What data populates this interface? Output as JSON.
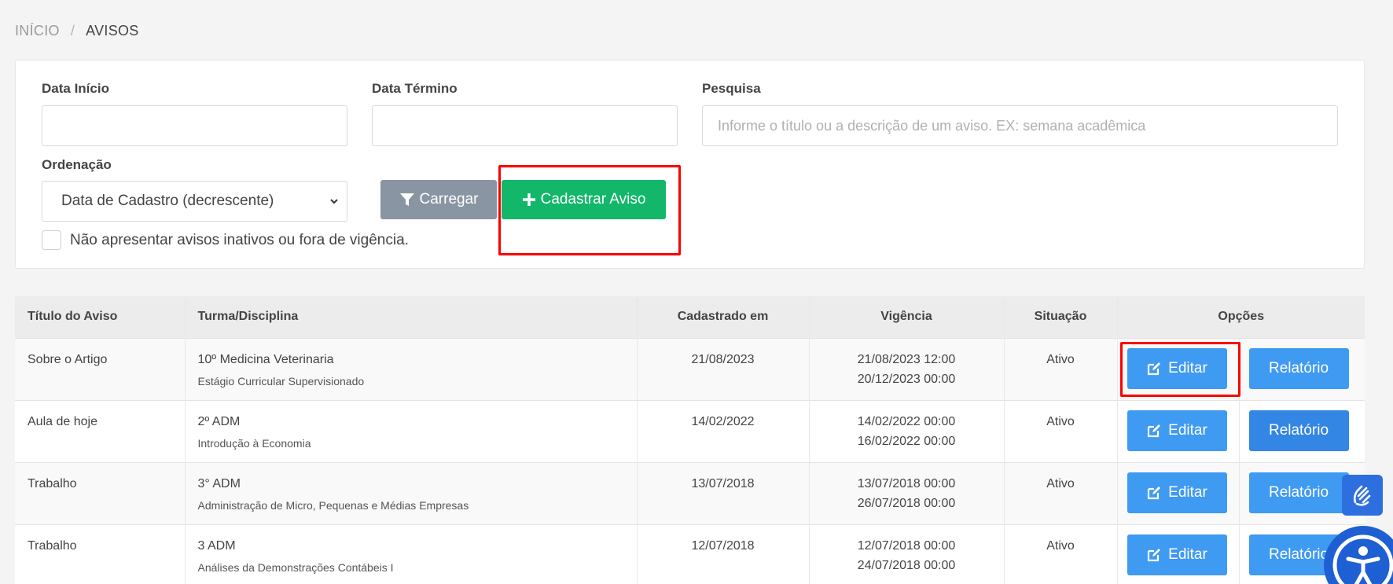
{
  "breadcrumb": {
    "home": "INÍCIO",
    "separator": "/",
    "current": "AVISOS"
  },
  "filters": {
    "start_label": "Data Início",
    "start_value": "",
    "end_label": "Data Término",
    "end_value": "",
    "search_label": "Pesquisa",
    "search_placeholder": "Informe o título ou a descrição de um aviso. EX: semana acadêmica",
    "search_value": "",
    "order_label": "Ordenação",
    "order_selected": "Data de Cadastro (decrescente)",
    "load_button": "Carregar",
    "new_button": "Cadastrar Aviso",
    "inactive_checkbox_label": "Não apresentar avisos inativos ou fora de vigência.",
    "inactive_checked": false
  },
  "table": {
    "headers": [
      "Título do Aviso",
      "Turma/Disciplina",
      "Cadastrado em",
      "Vigência",
      "Situação",
      "Opções"
    ],
    "rows": [
      {
        "title": "Sobre o Artigo",
        "class": "10º Medicina Veterinaria",
        "subject": "Estágio Curricular Supervisionado",
        "created": "21/08/2023",
        "start": "21/08/2023 12:00",
        "end": "20/12/2023 00:00",
        "status": "Ativo",
        "edit": "Editar",
        "report": "Relatório"
      },
      {
        "title": "Aula de hoje",
        "class": "2º ADM",
        "subject": "Introdução à Economia",
        "created": "14/02/2022",
        "start": "14/02/2022 00:00",
        "end": "16/02/2022 00:00",
        "status": "Ativo",
        "edit": "Editar",
        "report": "Relatório"
      },
      {
        "title": "Trabalho",
        "class": "3° ADM",
        "subject": "Administração de Micro, Pequenas e Médias Empresas",
        "created": "13/07/2018",
        "start": "13/07/2018 00:00",
        "end": "26/07/2018 00:00",
        "status": "Ativo",
        "edit": "Editar",
        "report": "Relatório"
      },
      {
        "title": "Trabalho",
        "class": "3 ADM",
        "subject": "Análises da Demonstrações Contábeis I",
        "created": "12/07/2018",
        "start": "12/07/2018 00:00",
        "end": "24/07/2018 00:00",
        "status": "Ativo",
        "edit": "Editar",
        "report": "Relatório"
      }
    ]
  },
  "colors": {
    "green": "#12b76a",
    "gray": "#8a95a3",
    "blue": "#3f9af2",
    "highlight": "#ff0000"
  },
  "icons": {
    "load": "filter-icon",
    "new": "plus-icon",
    "edit": "edit-icon",
    "float": "sign-language-icon",
    "accessibility": "accessibility-icon"
  }
}
